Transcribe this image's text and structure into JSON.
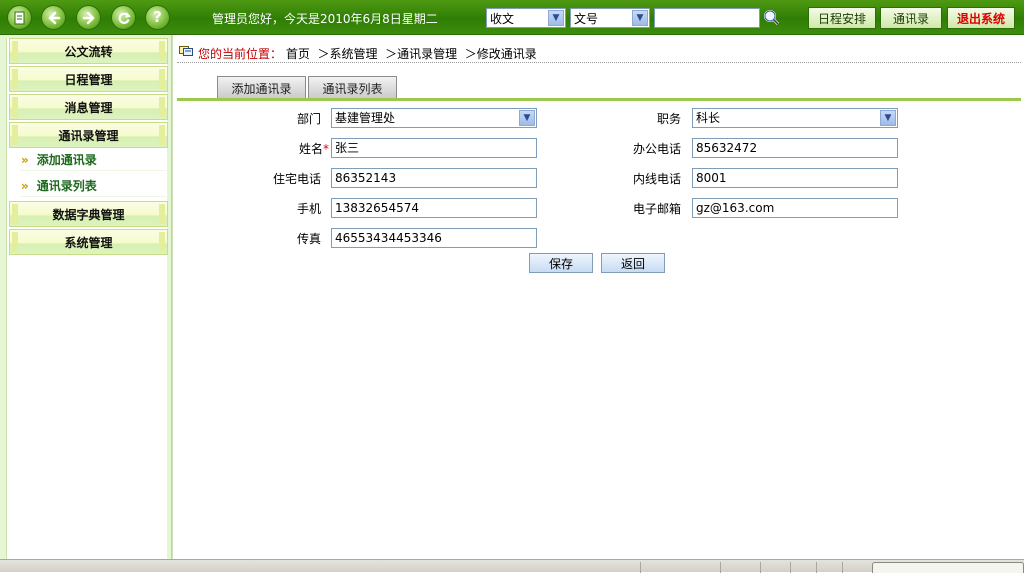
{
  "topbar": {
    "nav_icons": [
      "document-icon",
      "back-arrow-icon",
      "forward-arrow-icon",
      "refresh-icon",
      "help-icon"
    ],
    "greeting": "管理员您好，今天是2010年6月8日星期二",
    "select1": "收文",
    "select2": "文号",
    "search_value": "",
    "buttons": {
      "schedule": "日程安排",
      "contacts": "通讯录",
      "exit": "退出系统"
    }
  },
  "sidebar": {
    "menu1": "公文流转",
    "menu2": "日程管理",
    "menu3": "消息管理",
    "menu4": "通讯录管理",
    "sub1": "添加通讯录",
    "sub2": "通讯录列表",
    "menu5": "数据字典管理",
    "menu6": "系统管理"
  },
  "breadcrumb": {
    "label": "您的当前位置：",
    "path": "首页  ＞系统管理  ＞通讯录管理  ＞修改通讯录"
  },
  "tabs": {
    "add": "添加通讯录",
    "list": "通讯录列表"
  },
  "form": {
    "dept_label": "部门",
    "dept_value": "基建管理处",
    "position_label": "职务",
    "position_value": "科长",
    "name_label": "姓名",
    "name_required": "*",
    "name_value": "张三",
    "office_phone_label": "办公电话",
    "office_phone_value": "85632472",
    "home_phone_label": "住宅电话",
    "home_phone_value": "86352143",
    "ext_phone_label": "内线电话",
    "ext_phone_value": "8001",
    "mobile_label": "手机",
    "mobile_value": "13832654574",
    "email_label": "电子邮箱",
    "email_value": "gz@163.com",
    "fax_label": "传真",
    "fax_value": "46553434453346",
    "save_button": "保存",
    "back_button": "返回"
  },
  "colors": {
    "topbar": "#3a8a0a",
    "sidebar_bg": "#e6f6d4",
    "tab_underline": "#9cc94c",
    "breadcrumb_label": "#c00000",
    "exit_text": "#e00000"
  }
}
